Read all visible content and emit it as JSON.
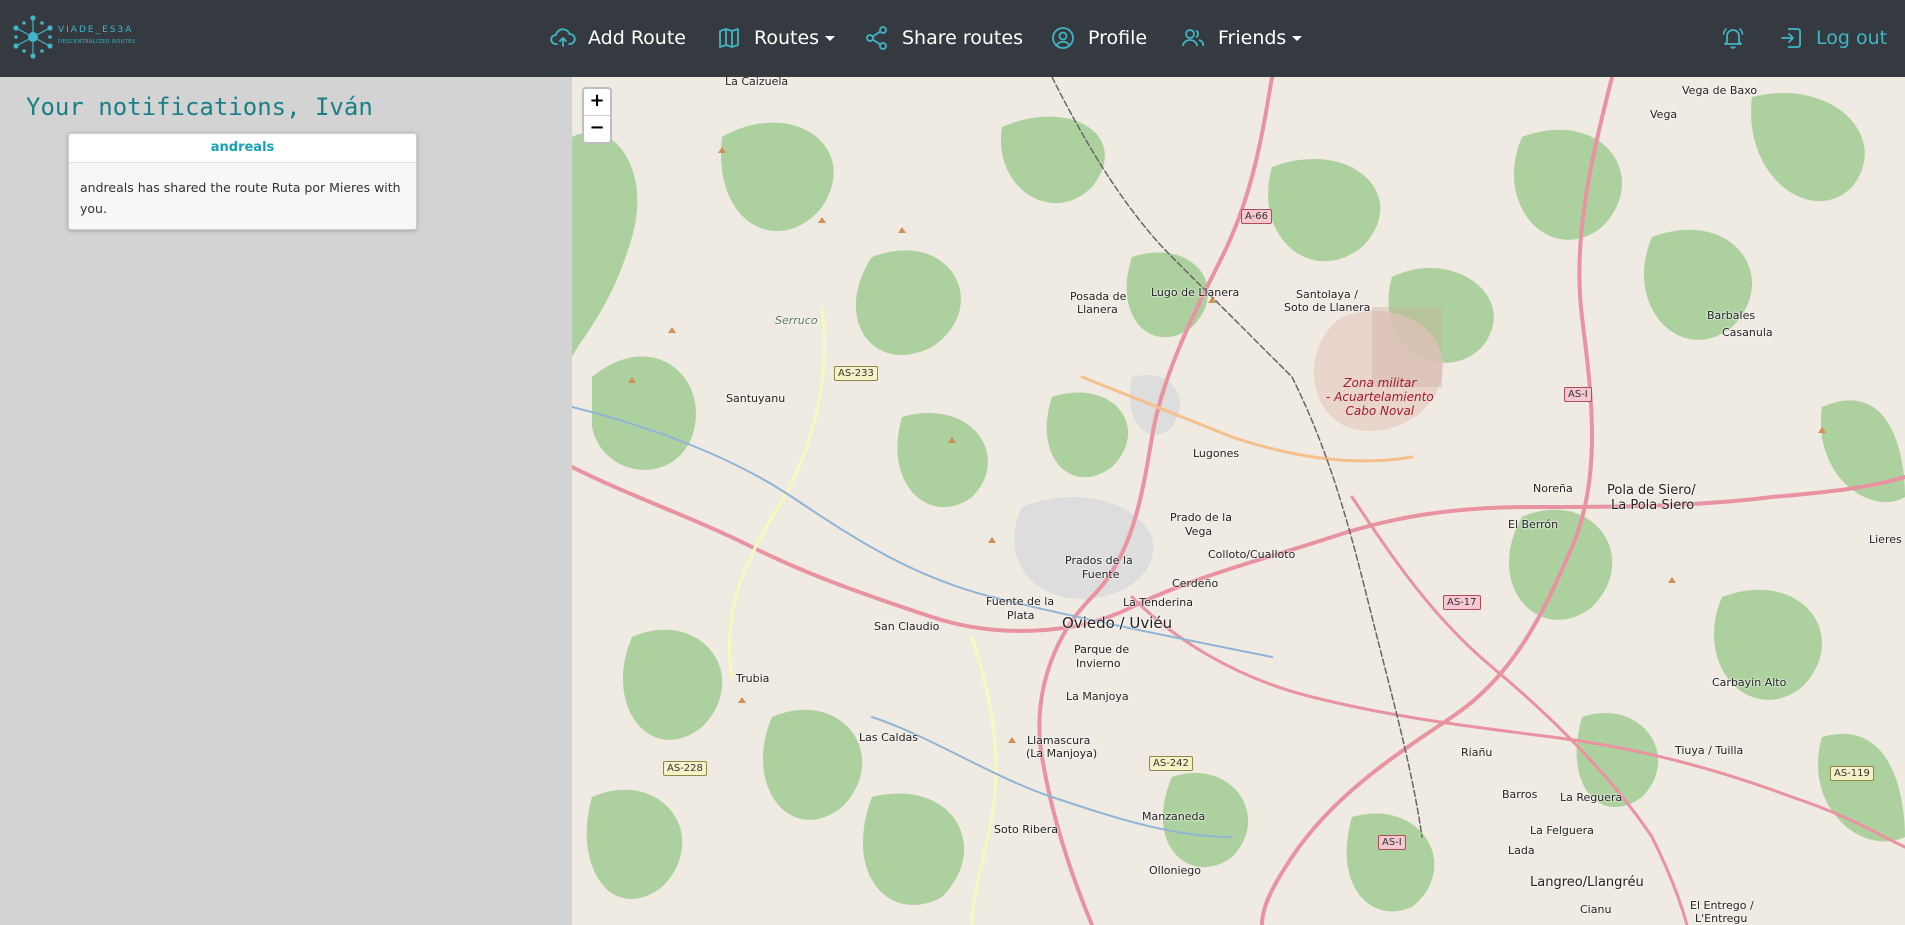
{
  "brand": {
    "name": "VIADE_ES3A",
    "tagline": "DESCENTRALIZED ROUTES"
  },
  "nav": {
    "add_route": "Add Route",
    "routes": "Routes",
    "share_routes": "Share routes",
    "profile": "Profile",
    "friends": "Friends",
    "logout": "Log out"
  },
  "page": {
    "title": "Your notifications, Iván"
  },
  "notification": {
    "sender": "andreals",
    "message": "andreals has shared the route Ruta por Mieres with you."
  },
  "map": {
    "zoom_in": "+",
    "zoom_out": "−",
    "labels": {
      "la_caizuela": "La Caizuela",
      "vega_de_baxo": "Vega de Baxo",
      "vega": "Vega",
      "posada_1": "Posada de",
      "posada_2": "Llanera",
      "lugo": "Lugo de Llanera",
      "santolaya_1": "Santolaya /",
      "santolaya_2": "Soto de Llanera",
      "serruco": "Serruco",
      "barbales": "Barbales",
      "casanula": "Casanula",
      "santuyanu": "Santuyanu",
      "lugones": "Lugones",
      "norena": "Noreña",
      "pola_1": "Pola de Siero/",
      "pola_2": "La Pola Siero",
      "el_berron": "El Berrón",
      "lieres": "Lieres",
      "prado_1": "Prado de la",
      "prado_2": "Vega",
      "colloto": "Colloto/Cualloto",
      "prados_1": "Prados de la",
      "prados_2": "Fuente",
      "cerdeno": "Cerdeño",
      "fuente_1": "Fuente de la",
      "fuente_2": "Plata",
      "la_tenderina": "La Tenderina",
      "oviedo": "Oviedo / Uviéu",
      "san_claudio": "San Claudio",
      "parque_1": "Parque de",
      "parque_2": "Invierno",
      "trubia": "Trubia",
      "la_manjoya": "La Manjoya",
      "carbayin": "Carbayin Alto",
      "las_caldas": "Las Caldas",
      "llamascura_1": "Llamascura",
      "llamascura_2": "(La Manjoya)",
      "tiuya": "Tiuya / Tuilla",
      "riano": "Riañu",
      "barros": "Barros",
      "la_reguera": "La Reguera",
      "manzaneda": "Manzaneda",
      "soto_ribera": "Soto Ribera",
      "la_felguera": "La Felguera",
      "lada": "Lada",
      "olloniego": "Olloniego",
      "langreo": "Langreo/Llangréu",
      "cianu": "Cianu",
      "el_entrego_1": "El Entrego /",
      "el_entrego_2": "L'Entregu"
    },
    "military": [
      "Zona militar",
      "- Acuartelamiento",
      "Cabo Noval"
    ],
    "shields": {
      "a66": "A-66",
      "as233": "AS-233",
      "as1a": "AS-I",
      "as17": "AS-17",
      "as228": "AS-228",
      "as242": "AS-242",
      "as1b": "AS-I",
      "as119": "AS-119"
    }
  },
  "colors": {
    "navbar": "#343a40",
    "accent": "#3fb6c6",
    "title": "#1a7f86",
    "sender": "#17a2b8",
    "sidebar": "#d3d3d3"
  }
}
